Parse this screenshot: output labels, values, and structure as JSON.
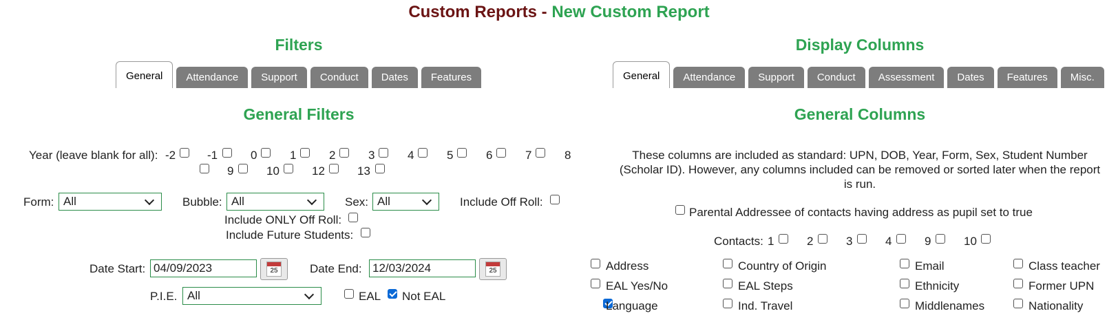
{
  "page": {
    "title_part1": "Custom Reports - ",
    "title_part2": "New Custom Report"
  },
  "filters": {
    "heading": "Filters",
    "tabs": [
      "General",
      "Attendance",
      "Support",
      "Conduct",
      "Dates",
      "Features"
    ],
    "active_tab": "General",
    "section_heading": "General Filters",
    "year_label": "Year (leave blank for all):",
    "years": [
      "-2",
      "-1",
      "0",
      "1",
      "2",
      "3",
      "4",
      "5",
      "6",
      "7",
      "8",
      "9",
      "10",
      "12",
      "13"
    ],
    "form_label": "Form:",
    "form_value": "All",
    "bubble_label": "Bubble:",
    "bubble_value": "All",
    "sex_label": "Sex:",
    "sex_value": "All",
    "include_off_roll": "Include Off Roll:",
    "include_only_off_roll": "Include ONLY Off Roll:",
    "include_future": "Include Future Students:",
    "date_start_label": "Date Start:",
    "date_start_value": "04/09/2023",
    "date_end_label": "Date End:",
    "date_end_value": "12/03/2024",
    "calendar_day": "25",
    "pie_label": "P.I.E.",
    "pie_value": "All",
    "eal_label": "EAL",
    "eal_checked": false,
    "not_eal_label": "Not EAL",
    "not_eal_checked": true
  },
  "display": {
    "heading": "Display Columns",
    "tabs": [
      "General",
      "Attendance",
      "Support",
      "Conduct",
      "Assessment",
      "Dates",
      "Features",
      "Misc."
    ],
    "active_tab": "General",
    "section_heading": "General Columns",
    "note": "These columns are included as standard: UPN, DOB, Year, Form, Sex, Student Number (Scholar ID). However, any columns included can be removed or sorted later when the report is run.",
    "note_lines": [
      "These columns are included as standard: UPN, DOB, Year, Form, Sex, Student Number",
      "(Scholar ID). However, any columns included can be removed or sorted later when the report",
      "is run."
    ],
    "parental_label": "Parental Addressee of contacts having address as pupil set to true",
    "contacts_label": "Contacts:",
    "contacts": [
      "1",
      "2",
      "3",
      "4",
      "9",
      "10"
    ],
    "columns": [
      {
        "label": "Address",
        "checked": false
      },
      {
        "label": "Country of Origin",
        "checked": false
      },
      {
        "label": "Email",
        "checked": false
      },
      {
        "label": "Class teacher",
        "checked": false
      },
      {
        "label": "EAL Yes/No",
        "checked": false
      },
      {
        "label": "EAL Steps",
        "checked": false
      },
      {
        "label": "Ethnicity",
        "checked": false
      },
      {
        "label": "Former UPN",
        "checked": false
      },
      {
        "label": "Language",
        "checked": true
      },
      {
        "label": "Ind. Travel",
        "checked": false
      },
      {
        "label": "Middlenames",
        "checked": false
      },
      {
        "label": "Nationality",
        "checked": false
      }
    ]
  }
}
